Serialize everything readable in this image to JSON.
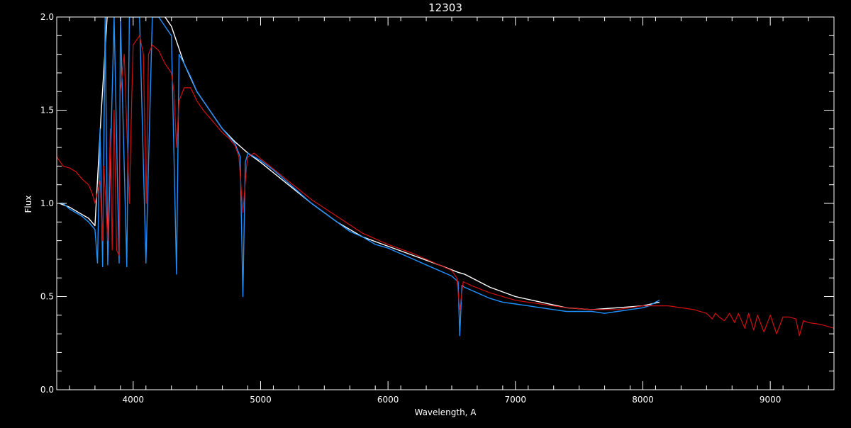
{
  "chart_data": {
    "type": "line",
    "title": "12303",
    "xlabel": "Wavelength, A",
    "ylabel": "Flux",
    "xlim": [
      3400,
      9500
    ],
    "ylim": [
      0.0,
      2.0
    ],
    "x_ticks": [
      4000,
      5000,
      6000,
      7000,
      8000,
      9000
    ],
    "y_ticks": [
      0.0,
      0.5,
      1.0,
      1.5,
      2.0
    ],
    "x_tick_labels": [
      "4000",
      "5000",
      "6000",
      "7000",
      "8000",
      "9000"
    ],
    "y_tick_labels": [
      "0.0",
      "0.5",
      "1.0",
      "1.5",
      "2.0"
    ],
    "grid": false,
    "colors": {
      "background": "#000000",
      "axes": "#ffffff",
      "observed_white": "#ffffff",
      "observed_blue": "#1e90ff",
      "model_red": "#d01010"
    },
    "series": [
      {
        "color": "#ffffff",
        "x": [
          3420,
          3500,
          3600,
          3650,
          3700,
          3750,
          3800,
          3900,
          4000,
          4100,
          4200,
          4300,
          4400,
          4500,
          4600,
          4700,
          4800,
          4850,
          4900,
          5000,
          5200,
          5400,
          5600,
          5800,
          6000,
          6200,
          6400,
          6550,
          6600,
          6800,
          7000,
          7200,
          7400,
          7600,
          7800,
          8000,
          8130
        ],
        "y": [
          1.0,
          0.98,
          0.94,
          0.92,
          0.88,
          1.5,
          2.05,
          2.1,
          2.1,
          2.1,
          2.05,
          1.95,
          1.75,
          1.6,
          1.5,
          1.4,
          1.33,
          1.3,
          1.27,
          1.22,
          1.11,
          1.0,
          0.9,
          0.82,
          0.77,
          0.72,
          0.67,
          0.63,
          0.62,
          0.55,
          0.5,
          0.47,
          0.44,
          0.43,
          0.44,
          0.45,
          0.47
        ]
      },
      {
        "color": "#1e90ff",
        "x": [
          3420,
          3450,
          3500,
          3550,
          3600,
          3650,
          3700,
          3720,
          3740,
          3760,
          3780,
          3800,
          3850,
          3890,
          3900,
          3950,
          3970,
          4000,
          4050,
          4100,
          4150,
          4200,
          4250,
          4300,
          4340,
          4360,
          4400,
          4450,
          4500,
          4550,
          4600,
          4650,
          4700,
          4750,
          4800,
          4840,
          4861,
          4880,
          4900,
          5000,
          5100,
          5200,
          5300,
          5400,
          5500,
          5600,
          5700,
          5800,
          5900,
          6000,
          6100,
          6200,
          6300,
          6400,
          6500,
          6550,
          6563,
          6580,
          6600,
          6700,
          6800,
          6900,
          7000,
          7100,
          7200,
          7300,
          7400,
          7500,
          7600,
          7700,
          7800,
          7900,
          8000,
          8050,
          8100,
          8130
        ],
        "y": [
          1.0,
          1.0,
          0.97,
          0.95,
          0.93,
          0.9,
          0.86,
          0.68,
          1.4,
          0.66,
          2.0,
          0.67,
          2.0,
          0.68,
          2.0,
          0.66,
          2.0,
          2.0,
          2.0,
          0.68,
          2.0,
          2.0,
          1.95,
          1.9,
          0.62,
          1.8,
          1.75,
          1.68,
          1.6,
          1.55,
          1.5,
          1.45,
          1.4,
          1.36,
          1.32,
          1.25,
          0.5,
          1.22,
          1.27,
          1.23,
          1.18,
          1.12,
          1.06,
          1.0,
          0.95,
          0.9,
          0.85,
          0.82,
          0.78,
          0.76,
          0.73,
          0.7,
          0.67,
          0.64,
          0.61,
          0.58,
          0.29,
          0.56,
          0.55,
          0.52,
          0.49,
          0.47,
          0.46,
          0.45,
          0.44,
          0.43,
          0.42,
          0.42,
          0.42,
          0.41,
          0.42,
          0.43,
          0.44,
          0.45,
          0.47,
          0.48
        ]
      },
      {
        "color": "#d01010",
        "x": [
          3400,
          3450,
          3500,
          3550,
          3600,
          3650,
          3680,
          3700,
          3740,
          3760,
          3770,
          3800,
          3820,
          3835,
          3850,
          3870,
          3889,
          3900,
          3930,
          3970,
          3990,
          4000,
          4050,
          4080,
          4102,
          4120,
          4150,
          4200,
          4250,
          4280,
          4300,
          4320,
          4340,
          4360,
          4400,
          4450,
          4480,
          4500,
          4550,
          4600,
          4650,
          4700,
          4750,
          4800,
          4830,
          4861,
          4890,
          4900,
          4950,
          5000,
          5200,
          5400,
          5600,
          5800,
          6000,
          6200,
          6400,
          6500,
          6540,
          6563,
          6590,
          6650,
          6800,
          7000,
          7200,
          7400,
          7600,
          7800,
          8000,
          8200,
          8400,
          8500,
          8545,
          8570,
          8600,
          8640,
          8680,
          8720,
          8750,
          8800,
          8830,
          8870,
          8900,
          8950,
          9000,
          9050,
          9100,
          9150,
          9200,
          9229,
          9260,
          9300,
          9400,
          9500
        ],
        "y": [
          1.25,
          1.2,
          1.19,
          1.17,
          1.13,
          1.1,
          1.05,
          1.0,
          1.12,
          0.8,
          1.2,
          0.8,
          1.4,
          0.75,
          1.5,
          0.75,
          0.72,
          1.6,
          1.8,
          1.0,
          1.6,
          1.85,
          1.9,
          1.8,
          1.0,
          1.8,
          1.85,
          1.82,
          1.75,
          1.72,
          1.7,
          1.6,
          1.3,
          1.55,
          1.62,
          1.62,
          1.58,
          1.55,
          1.5,
          1.46,
          1.42,
          1.38,
          1.35,
          1.31,
          1.25,
          0.95,
          1.2,
          1.25,
          1.27,
          1.24,
          1.13,
          1.02,
          0.93,
          0.84,
          0.78,
          0.73,
          0.67,
          0.64,
          0.6,
          0.43,
          0.58,
          0.56,
          0.52,
          0.48,
          0.46,
          0.44,
          0.43,
          0.43,
          0.45,
          0.45,
          0.43,
          0.41,
          0.38,
          0.41,
          0.39,
          0.37,
          0.41,
          0.36,
          0.41,
          0.33,
          0.41,
          0.32,
          0.4,
          0.31,
          0.4,
          0.3,
          0.39,
          0.39,
          0.38,
          0.29,
          0.37,
          0.36,
          0.35,
          0.33
        ]
      }
    ]
  }
}
